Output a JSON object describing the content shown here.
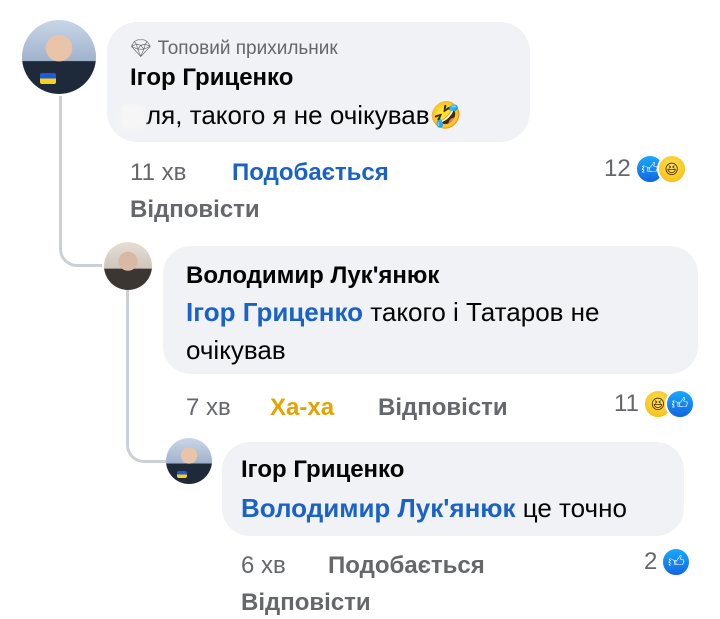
{
  "comments": [
    {
      "badge": "Топовий прихильник",
      "author": "Ігор Гриценко",
      "text": "ля, такого я не очікував",
      "emoji": "🤣",
      "time": "11 хв",
      "action1": "Подобається",
      "reply": "Відповісти",
      "reaction_count": "12",
      "reactions": [
        "like-icon",
        "haha-icon"
      ]
    },
    {
      "author": "Володимир Лук'янюк",
      "mention": "Ігор Гриценко",
      "text_line1": "такого і Татаров не",
      "text_line2": "очікував",
      "time": "7 хв",
      "action1": "Ха-ха",
      "reply": "Відповісти",
      "reaction_count": "11",
      "reactions": [
        "haha-icon",
        "like-icon"
      ]
    },
    {
      "author": "Ігор Гриценко",
      "mention": "Володимир Лук'янюк",
      "text": "це точно",
      "time": "6 хв",
      "action1": "Подобається",
      "reply": "Відповісти",
      "reaction_count": "2",
      "reactions": [
        "like-icon"
      ]
    }
  ],
  "colors": {
    "bubble": "#f0f2f5",
    "link": "#1a62c7",
    "haha": "#e6a300",
    "meta": "#65676b"
  }
}
